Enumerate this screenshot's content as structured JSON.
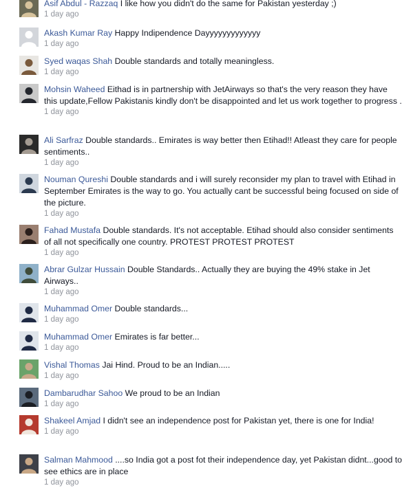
{
  "comments": [
    {
      "author": "Asif Abdul - Razzaq",
      "text": "I like how you didn't do the same for Pakistan yesterday ;)",
      "time": "1 day ago",
      "avatar": "photo-avatar",
      "bg": "#6b6a55",
      "fg": "#d7c39c"
    },
    {
      "author": "Akash Kumar Ray",
      "text": "Happy Indipendence Dayyyyyyyyyyyyy",
      "time": "1 day ago",
      "avatar": "default-avatar",
      "bg": "#d3d6db",
      "fg": "#ffffff"
    },
    {
      "author": "Syed waqas Shah",
      "text": "Double standards and totally meaningless.",
      "time": "1 day ago",
      "avatar": "photo-avatar",
      "bg": "#e8e6e2",
      "fg": "#7a5a3c"
    },
    {
      "author": "Mohsin Waheed",
      "text": "Eithad is in partnership with JetAirways so that's the very reason they have this update,Fellow Pakistanis kindly don't be disappointed and let us work together to progress .",
      "time": "1 day ago",
      "avatar": "photo-avatar",
      "bg": "#c9c9c9",
      "fg": "#23262d"
    },
    {
      "author": "Ali Sarfraz",
      "text": "Double standards.. Emirates is way better then Etihad!! Atleast they care for people sentiments..",
      "time": "1 day ago",
      "avatar": "photo-avatar",
      "bg": "#2a2a2a",
      "fg": "#a49b92"
    },
    {
      "author": "Nouman Qureshi",
      "text": "Double standards and i will surely reconsider my plan to travel with Etihad in September Emirates is the way to go. You actually cant be successful being focused on side of the picture.",
      "time": "1 day ago",
      "avatar": "photo-avatar",
      "bg": "#cfd6de",
      "fg": "#2b3a4f"
    },
    {
      "author": "Fahad Mustafa",
      "text": "Double standards. It's not acceptable. Etihad should also consider sentiments of all not specifically one country. PROTEST PROTEST PROTEST",
      "time": "1 day ago",
      "avatar": "photo-avatar",
      "bg": "#9a7f70",
      "fg": "#2b1f1c"
    },
    {
      "author": "Abrar Gulzar Hussain",
      "text": "Double Standards.. Actually they are buying the 49% stake in Jet Airways..",
      "time": "1 day ago",
      "avatar": "photo-avatar",
      "bg": "#8fb1c9",
      "fg": "#3f4c3a"
    },
    {
      "author": "Muhammad Omer",
      "text": "Double standards...",
      "time": "1 day ago",
      "avatar": "photo-avatar",
      "bg": "#dfe4ea",
      "fg": "#1f2a44"
    },
    {
      "author": "Muhammad Omer",
      "text": "Emirates is far better...",
      "time": "1 day ago",
      "avatar": "photo-avatar",
      "bg": "#dfe4ea",
      "fg": "#1f2a44"
    },
    {
      "author": "Vishal Thomas",
      "text": "Jai Hind. Proud to be an Indian.....",
      "time": "1 day ago",
      "avatar": "photo-avatar",
      "bg": "#6aa36a",
      "fg": "#c8a98a"
    },
    {
      "author": "Dambarudhar Sahoo",
      "text": "We proud to be an Indian",
      "time": "1 day ago",
      "avatar": "photo-avatar",
      "bg": "#5a6a7c",
      "fg": "#1b1e24"
    },
    {
      "author": "Shakeel Amjad",
      "text": "I didn't see an independence post for Pakistan yet, there is one for India!",
      "time": "1 day ago",
      "avatar": "photo-avatar",
      "bg": "#b53a2e",
      "fg": "#f0e6dd"
    },
    {
      "author": "Salman Mahmood",
      "text": "....so India got a post fot their independence day, yet Pakistan didnt...good to see ethics are in place",
      "time": "1 day ago",
      "avatar": "photo-avatar",
      "bg": "#3d4048",
      "fg": "#c9a886"
    }
  ]
}
